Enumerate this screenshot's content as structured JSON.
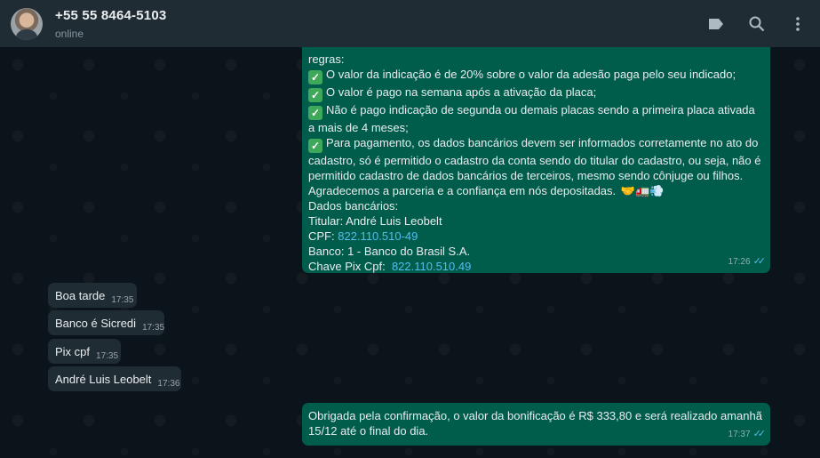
{
  "header": {
    "contact_name": "+55 55 8464-5103",
    "status": "online",
    "icons": [
      "label-icon",
      "search-icon",
      "menu-icon"
    ]
  },
  "messages": {
    "big": {
      "lines": [
        "regras:",
        "O valor da indicação é de 20% sobre o valor da adesão paga pelo seu indicado;",
        "O valor é pago na semana após a ativação da placa;",
        "Não é pago indicação de segunda ou demais placas sendo a primeira placa ativada a mais de 4 meses;",
        "Para pagamento, os dados bancários devem ser informados corretamente no ato do cadastro, só é permitido o cadastro da conta sendo do titular do cadastro, ou seja, não é permitido cadastro de dados bancários de terceiros, mesmo sendo cônjuge ou filhos.",
        "Agradecemos a parceria e a confiança em nós depositadas.",
        "Dados bancários:",
        "Titular: André Luis Leobelt",
        "CPF:",
        "Banco: 1 - Banco do Brasil S.A.",
        "Chave Pix Cpf:"
      ],
      "cpf_link": "822.110.510-49",
      "pix_link": "822.110.510.49",
      "emojis": "🤝🚛💨",
      "time": "17:26"
    },
    "incoming": [
      {
        "text": "Boa tarde",
        "time": "17:35"
      },
      {
        "text": "Banco é Sicredi",
        "time": "17:35"
      },
      {
        "text": "Pix cpf",
        "time": "17:35"
      },
      {
        "text": "André Luis Leobelt",
        "time": "17:36"
      }
    ],
    "final": {
      "text": "Obrigada pela confirmação, o valor da bonificação é R$ 333,80 e será realizado amanhã 15/12 até o final do dia.",
      "time": "17:37"
    }
  },
  "colors": {
    "header_bg": "#202c33",
    "chat_bg": "#0b141a",
    "outgoing_bubble": "#005c4b",
    "incoming_bubble": "#202c33",
    "link": "#53bdeb"
  }
}
